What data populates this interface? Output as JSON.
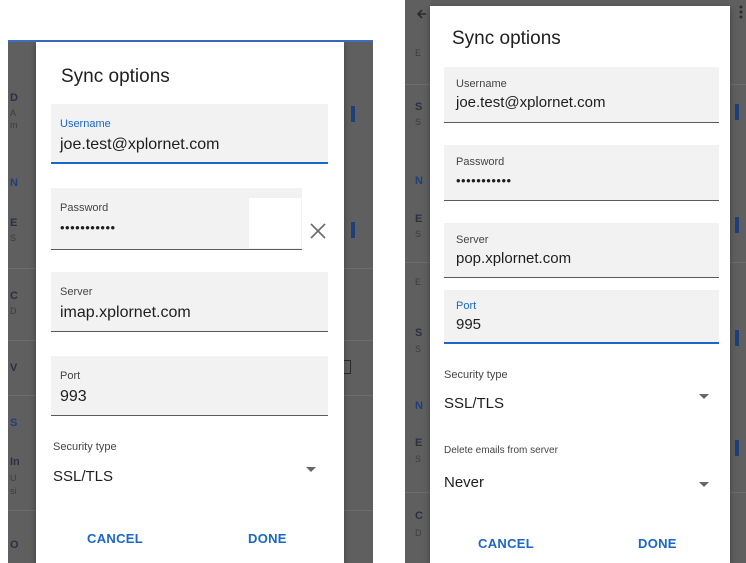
{
  "left": {
    "background": {
      "letters": [
        "D",
        "A",
        "m",
        "N",
        "E",
        "S",
        "C",
        "D",
        "V",
        "S",
        "In",
        "U",
        "si",
        "O"
      ]
    },
    "dialog": {
      "title": "Sync options",
      "username": {
        "label": "Username",
        "value": "joe.test@xplornet.com"
      },
      "password": {
        "label": "Password",
        "value": "•••••••••••"
      },
      "server": {
        "label": "Server",
        "value": "imap.xplornet.com"
      },
      "port": {
        "label": "Port",
        "value": "993"
      },
      "security": {
        "label": "Security type",
        "value": "SSL/TLS"
      },
      "cancel_label": "CANCEL",
      "done_label": "DONE"
    }
  },
  "right": {
    "background": {
      "letters": [
        "E",
        "S",
        "S",
        "N",
        "E",
        "S",
        "E",
        "S",
        "S",
        "N",
        "E",
        "S",
        "C",
        "D"
      ]
    },
    "dialog": {
      "title": "Sync options",
      "username": {
        "label": "Username",
        "value": "joe.test@xplornet.com"
      },
      "password": {
        "label": "Password",
        "value": "•••••••••••"
      },
      "server": {
        "label": "Server",
        "value": "pop.xplornet.com"
      },
      "port": {
        "label": "Port",
        "value": "995"
      },
      "security": {
        "label": "Security type",
        "value": "SSL/TLS"
      },
      "delete": {
        "label": "Delete emails from server",
        "value": "Never"
      },
      "cancel_label": "CANCEL",
      "done_label": "DONE"
    }
  },
  "colors": {
    "accent": "#1a66c9",
    "field_bg": "#f2f2f2",
    "scrim": "#5f5f5f"
  },
  "icons": [
    "clear-x-icon",
    "dropdown-caret-icon",
    "overflow-menu-icon",
    "back-arrow-icon"
  ]
}
